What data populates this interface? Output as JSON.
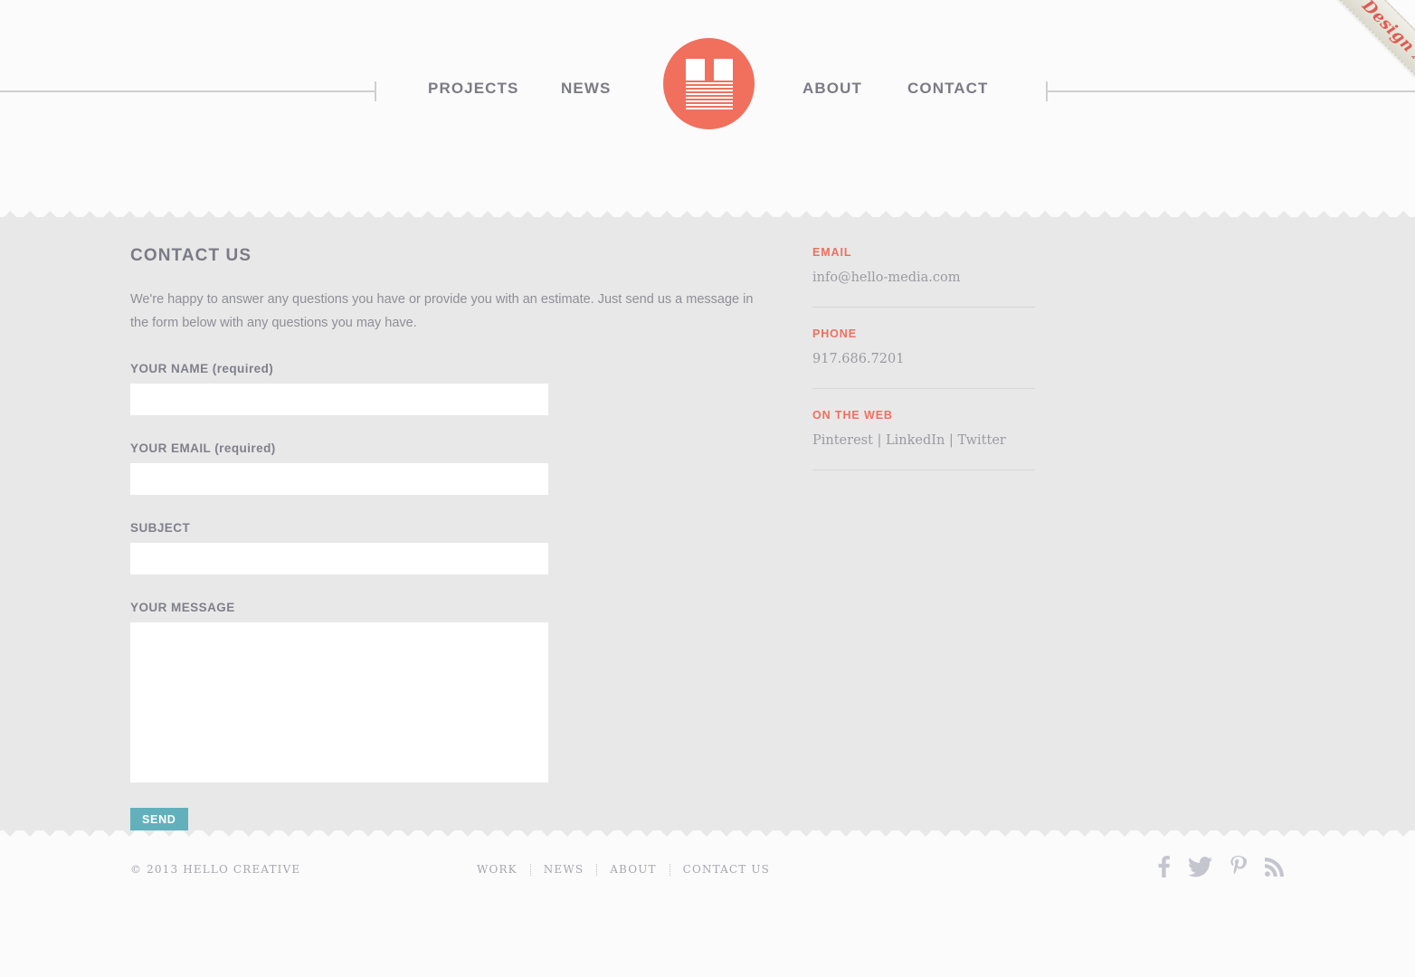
{
  "header": {
    "logo": {
      "name": "hello-creative-logo",
      "color": "#f0705d"
    },
    "nav": [
      {
        "label": "PROJECTS"
      },
      {
        "label": "NEWS"
      },
      {
        "label": "ABOUT"
      },
      {
        "label": "CONTACT"
      }
    ],
    "ribbon": {
      "text": "Design Award",
      "text_color": "#e05a52",
      "bg_color": "#e6e4d9"
    }
  },
  "main": {
    "title": "CONTACT US",
    "intro": "We're happy to answer any questions you have or provide you with an estimate. Just send us a message in the form below with any questions you may have.",
    "form": {
      "fields": [
        {
          "label": "YOUR NAME (required)",
          "value": "",
          "placeholder": ""
        },
        {
          "label": "YOUR EMAIL (required)",
          "value": "",
          "placeholder": ""
        },
        {
          "label": "SUBJECT",
          "value": "",
          "placeholder": ""
        },
        {
          "label": "YOUR MESSAGE",
          "value": "",
          "placeholder": ""
        }
      ],
      "submit_label": "SEND",
      "submit_color": "#63b0bd"
    }
  },
  "sidebar": {
    "accent_color": "#ef6f5f",
    "blocks": [
      {
        "label": "EMAIL",
        "value": "info@hello-media.com"
      },
      {
        "label": "PHONE",
        "value": "917.686.7201"
      },
      {
        "label": "ON THE WEB",
        "value": "Pinterest | LinkedIn | Twitter"
      }
    ],
    "web_links": [
      {
        "label": "Pinterest"
      },
      {
        "label": "LinkedIn"
      },
      {
        "label": "Twitter"
      }
    ],
    "link_separator": "|"
  },
  "footer": {
    "copyright": "© 2013 HELLO CREATIVE",
    "nav": [
      {
        "label": "WORK"
      },
      {
        "label": "NEWS"
      },
      {
        "label": "ABOUT"
      },
      {
        "label": "CONTACT US"
      }
    ],
    "socials": [
      {
        "name": "facebook-icon"
      },
      {
        "name": "twitter-icon"
      },
      {
        "name": "pinterest-icon"
      },
      {
        "name": "rss-icon"
      }
    ]
  },
  "theme": {
    "page_bg": "#fbfbfb",
    "body_bg": "#e8e8e8",
    "text_muted": "#8e8e97",
    "heading": "#7b7b86"
  }
}
